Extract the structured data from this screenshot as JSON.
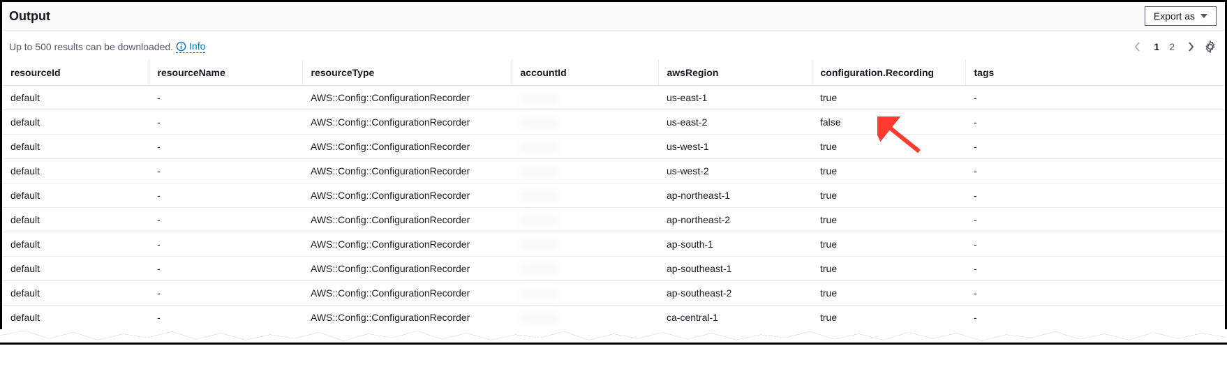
{
  "header": {
    "title": "Output",
    "export_label": "Export as"
  },
  "subheader": {
    "download_text": "Up to 500 results can be downloaded.",
    "info_label": "Info"
  },
  "pagination": {
    "pages": [
      "1",
      "2"
    ],
    "active_index": 0
  },
  "columns": [
    "resourceId",
    "resourceName",
    "resourceType",
    "accountId",
    "awsRegion",
    "configuration.Recording",
    "tags"
  ],
  "rows": [
    {
      "resourceId": "default",
      "resourceName": "-",
      "resourceType": "AWS::Config::ConfigurationRecorder",
      "accountId": "············",
      "awsRegion": "us-east-1",
      "configurationRecording": "true",
      "tags": "-"
    },
    {
      "resourceId": "default",
      "resourceName": "-",
      "resourceType": "AWS::Config::ConfigurationRecorder",
      "accountId": "············",
      "awsRegion": "us-east-2",
      "configurationRecording": "false",
      "tags": "-"
    },
    {
      "resourceId": "default",
      "resourceName": "-",
      "resourceType": "AWS::Config::ConfigurationRecorder",
      "accountId": "············",
      "awsRegion": "us-west-1",
      "configurationRecording": "true",
      "tags": "-"
    },
    {
      "resourceId": "default",
      "resourceName": "-",
      "resourceType": "AWS::Config::ConfigurationRecorder",
      "accountId": "············",
      "awsRegion": "us-west-2",
      "configurationRecording": "true",
      "tags": "-"
    },
    {
      "resourceId": "default",
      "resourceName": "-",
      "resourceType": "AWS::Config::ConfigurationRecorder",
      "accountId": "············",
      "awsRegion": "ap-northeast-1",
      "configurationRecording": "true",
      "tags": "-"
    },
    {
      "resourceId": "default",
      "resourceName": "-",
      "resourceType": "AWS::Config::ConfigurationRecorder",
      "accountId": "············",
      "awsRegion": "ap-northeast-2",
      "configurationRecording": "true",
      "tags": "-"
    },
    {
      "resourceId": "default",
      "resourceName": "-",
      "resourceType": "AWS::Config::ConfigurationRecorder",
      "accountId": "············",
      "awsRegion": "ap-south-1",
      "configurationRecording": "true",
      "tags": "-"
    },
    {
      "resourceId": "default",
      "resourceName": "-",
      "resourceType": "AWS::Config::ConfigurationRecorder",
      "accountId": "············",
      "awsRegion": "ap-southeast-1",
      "configurationRecording": "true",
      "tags": "-"
    },
    {
      "resourceId": "default",
      "resourceName": "-",
      "resourceType": "AWS::Config::ConfigurationRecorder",
      "accountId": "············",
      "awsRegion": "ap-southeast-2",
      "configurationRecording": "true",
      "tags": "-"
    },
    {
      "resourceId": "default",
      "resourceName": "-",
      "resourceType": "AWS::Config::ConfigurationRecorder",
      "accountId": "············",
      "awsRegion": "ca-central-1",
      "configurationRecording": "true",
      "tags": "-"
    }
  ]
}
